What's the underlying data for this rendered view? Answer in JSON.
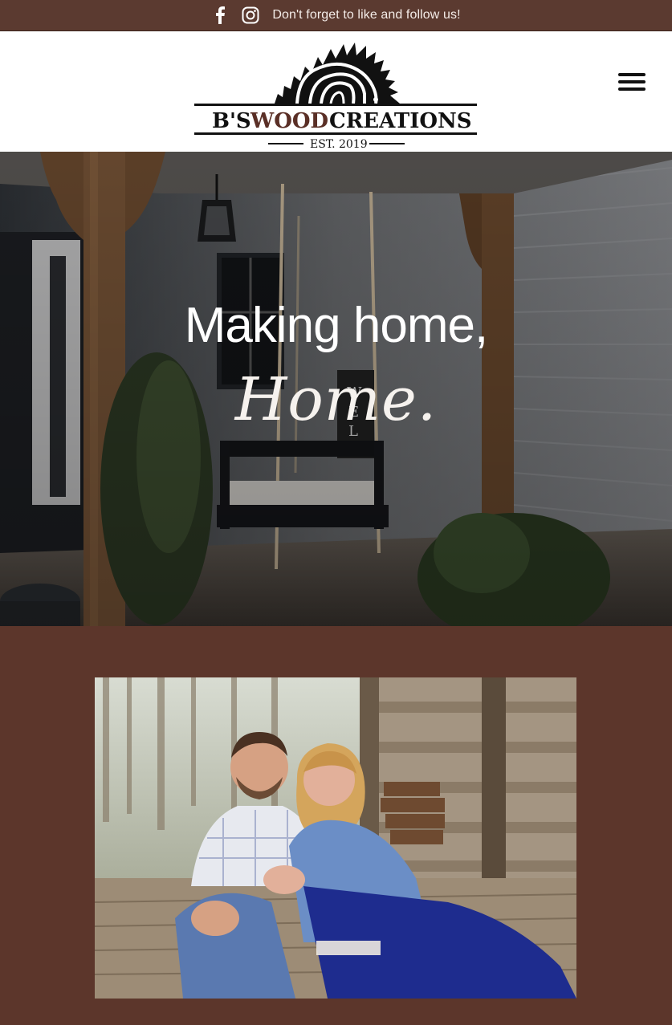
{
  "topbar": {
    "message": "Don't forget to like and follow us!",
    "icons": [
      "facebook-icon",
      "instagram-icon"
    ],
    "background": "#5b3a30"
  },
  "header": {
    "logo": {
      "brand_prefix": "B'S",
      "brand_wood": "WOOD",
      "brand_suffix": "CREATIONS",
      "established": "EST. 2019"
    },
    "menu_icon": "hamburger-menu-icon"
  },
  "hero": {
    "headline": "Making home,",
    "script_word": "Home."
  },
  "about": {
    "background": "#5c362b",
    "photo_description_icon": "couple-photo"
  },
  "colors": {
    "brown_accent": "#5c362b",
    "logo_wood": "#5a2f26"
  }
}
